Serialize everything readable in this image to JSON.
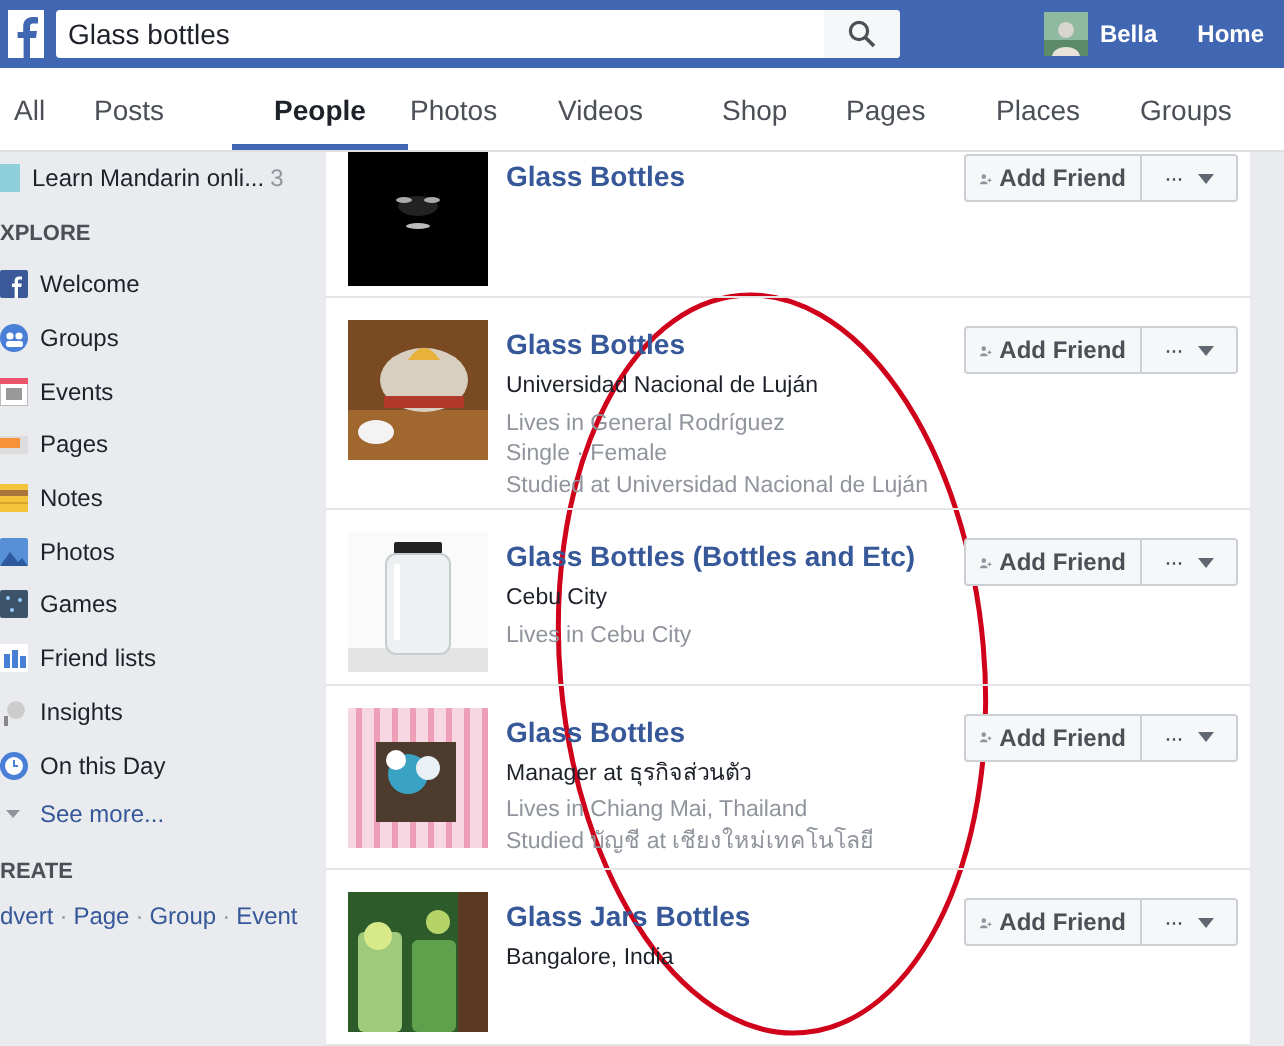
{
  "header": {
    "search": {
      "value": "Glass bottles"
    },
    "user": "Bella",
    "home": "Home"
  },
  "tabs": [
    {
      "label": "All",
      "selected": false
    },
    {
      "label": "Posts",
      "selected": false
    },
    {
      "label": "People",
      "selected": true
    },
    {
      "label": "Photos",
      "selected": false
    },
    {
      "label": "Videos",
      "selected": false
    },
    {
      "label": "Shop",
      "selected": false
    },
    {
      "label": "Pages",
      "selected": false
    },
    {
      "label": "Places",
      "selected": false
    },
    {
      "label": "Groups",
      "selected": false
    }
  ],
  "sidebar": {
    "shortcut": {
      "label": "Learn Mandarin onli...",
      "count": "3"
    },
    "explore_heading": "XPLORE",
    "items": [
      {
        "label": "Welcome",
        "kind": "welcome"
      },
      {
        "label": "Groups",
        "kind": "groups"
      },
      {
        "label": "Events",
        "kind": "events"
      },
      {
        "label": "Pages",
        "kind": "pages"
      },
      {
        "label": "Notes",
        "kind": "notes"
      },
      {
        "label": "Photos",
        "kind": "photos"
      },
      {
        "label": "Games",
        "kind": "games"
      },
      {
        "label": "Friend lists",
        "kind": "friends"
      },
      {
        "label": "Insights",
        "kind": "insights"
      },
      {
        "label": "On this Day",
        "kind": "onthisday"
      }
    ],
    "see_more": "See more...",
    "create_heading": "REATE",
    "create_links": [
      "dvert",
      "Page",
      "Group",
      "Event"
    ],
    "separator": "·"
  },
  "results": [
    {
      "name": "Glass Bottles",
      "button": "Add Friend",
      "more": "···"
    },
    {
      "name": "Glass Bottles",
      "details": [
        {
          "text": "Universidad Nacional de Luján",
          "primary": true
        },
        {
          "text": "Lives in General Rodríguez",
          "primary": false
        },
        {
          "text": "Single · Female",
          "primary": false
        },
        {
          "text": "Studied at Universidad Nacional de Luján",
          "primary": false
        }
      ],
      "button": "Add Friend",
      "more": "···"
    },
    {
      "name": "Glass Bottles (Bottles and Etc)",
      "details": [
        {
          "text": "Cebu City",
          "primary": true
        },
        {
          "text": "Lives in Cebu City",
          "primary": false
        }
      ],
      "button": "Add Friend",
      "more": "···"
    },
    {
      "name": "Glass Bottles",
      "details": [
        {
          "text": "Manager at ธุรกิจส่วนตัว",
          "primary": true
        },
        {
          "text": "Lives in Chiang Mai, Thailand",
          "primary": false
        },
        {
          "text": "Studied บัญชี at เชียงใหม่เทคโนโลยี",
          "primary": false
        }
      ],
      "button": "Add Friend",
      "more": "···"
    },
    {
      "name": "Glass Jars Bottles",
      "details": [
        {
          "text": "Bangalore, India",
          "primary": true
        }
      ],
      "button": "Add Friend",
      "more": "···"
    }
  ],
  "annotation": {
    "kind": "ellipse",
    "color": "#d0021b"
  }
}
